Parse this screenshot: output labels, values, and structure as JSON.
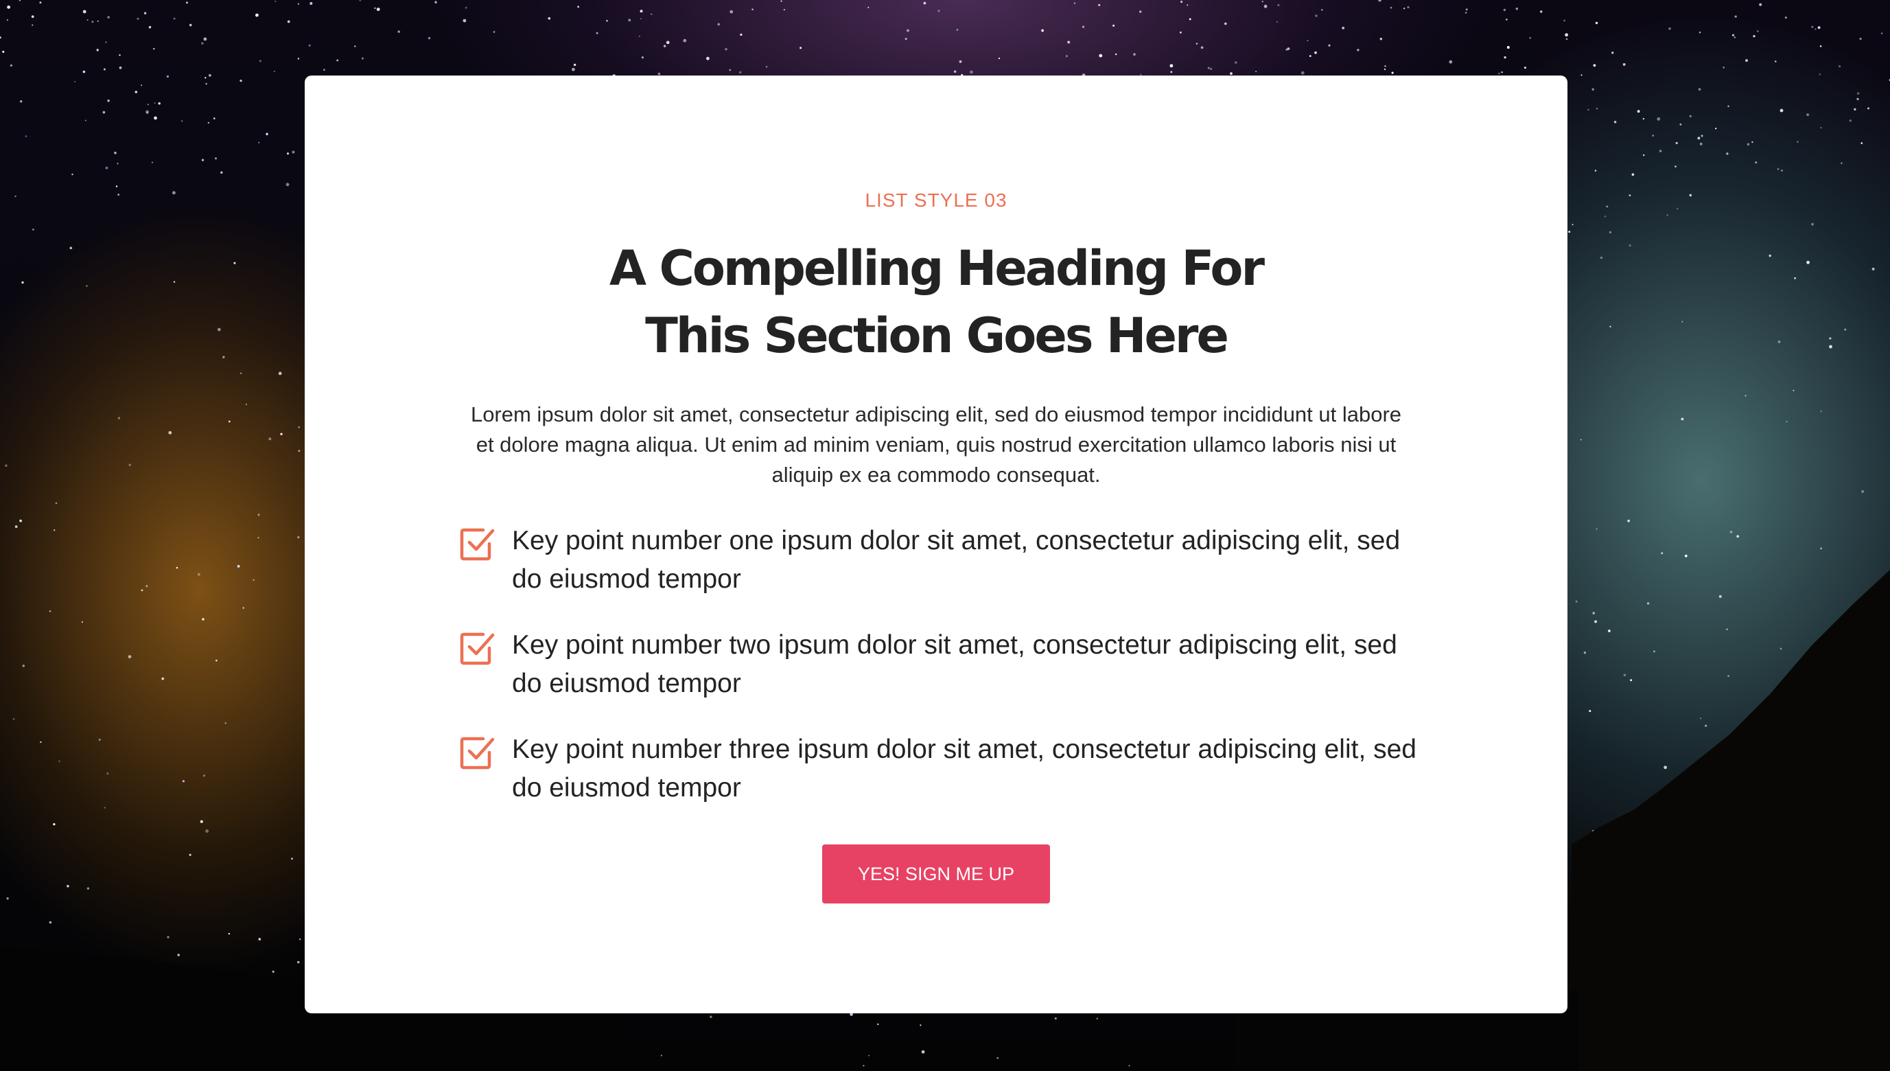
{
  "section": {
    "eyebrow": "LIST STYLE 03",
    "heading_line1": "A Compelling Heading For",
    "heading_line2": "This Section Goes Here",
    "intro": "Lorem ipsum dolor sit amet, consectetur adipiscing elit, sed do eiusmod tempor incididunt ut labore et dolore magna aliqua. Ut enim ad minim veniam, quis nostrud exercitation ullamco laboris nisi ut aliquip ex ea commodo consequat.",
    "points": [
      {
        "icon": "checkbox-check-icon",
        "text": "Key point number one ipsum dolor sit amet, consectetur adipiscing elit, sed do eiusmod tempor"
      },
      {
        "icon": "checkbox-check-icon",
        "text": "Key point number two ipsum dolor sit amet, consectetur adipiscing elit, sed do eiusmod tempor"
      },
      {
        "icon": "checkbox-check-icon",
        "text": "Key point number three ipsum dolor sit amet, consectetur adipiscing elit, sed do eiusmod tempor"
      }
    ],
    "cta_label": "YES! SIGN ME UP"
  },
  "colors": {
    "accent": "#ec7052",
    "button": "#e74264",
    "heading": "#232323",
    "card": "#ffffff"
  }
}
